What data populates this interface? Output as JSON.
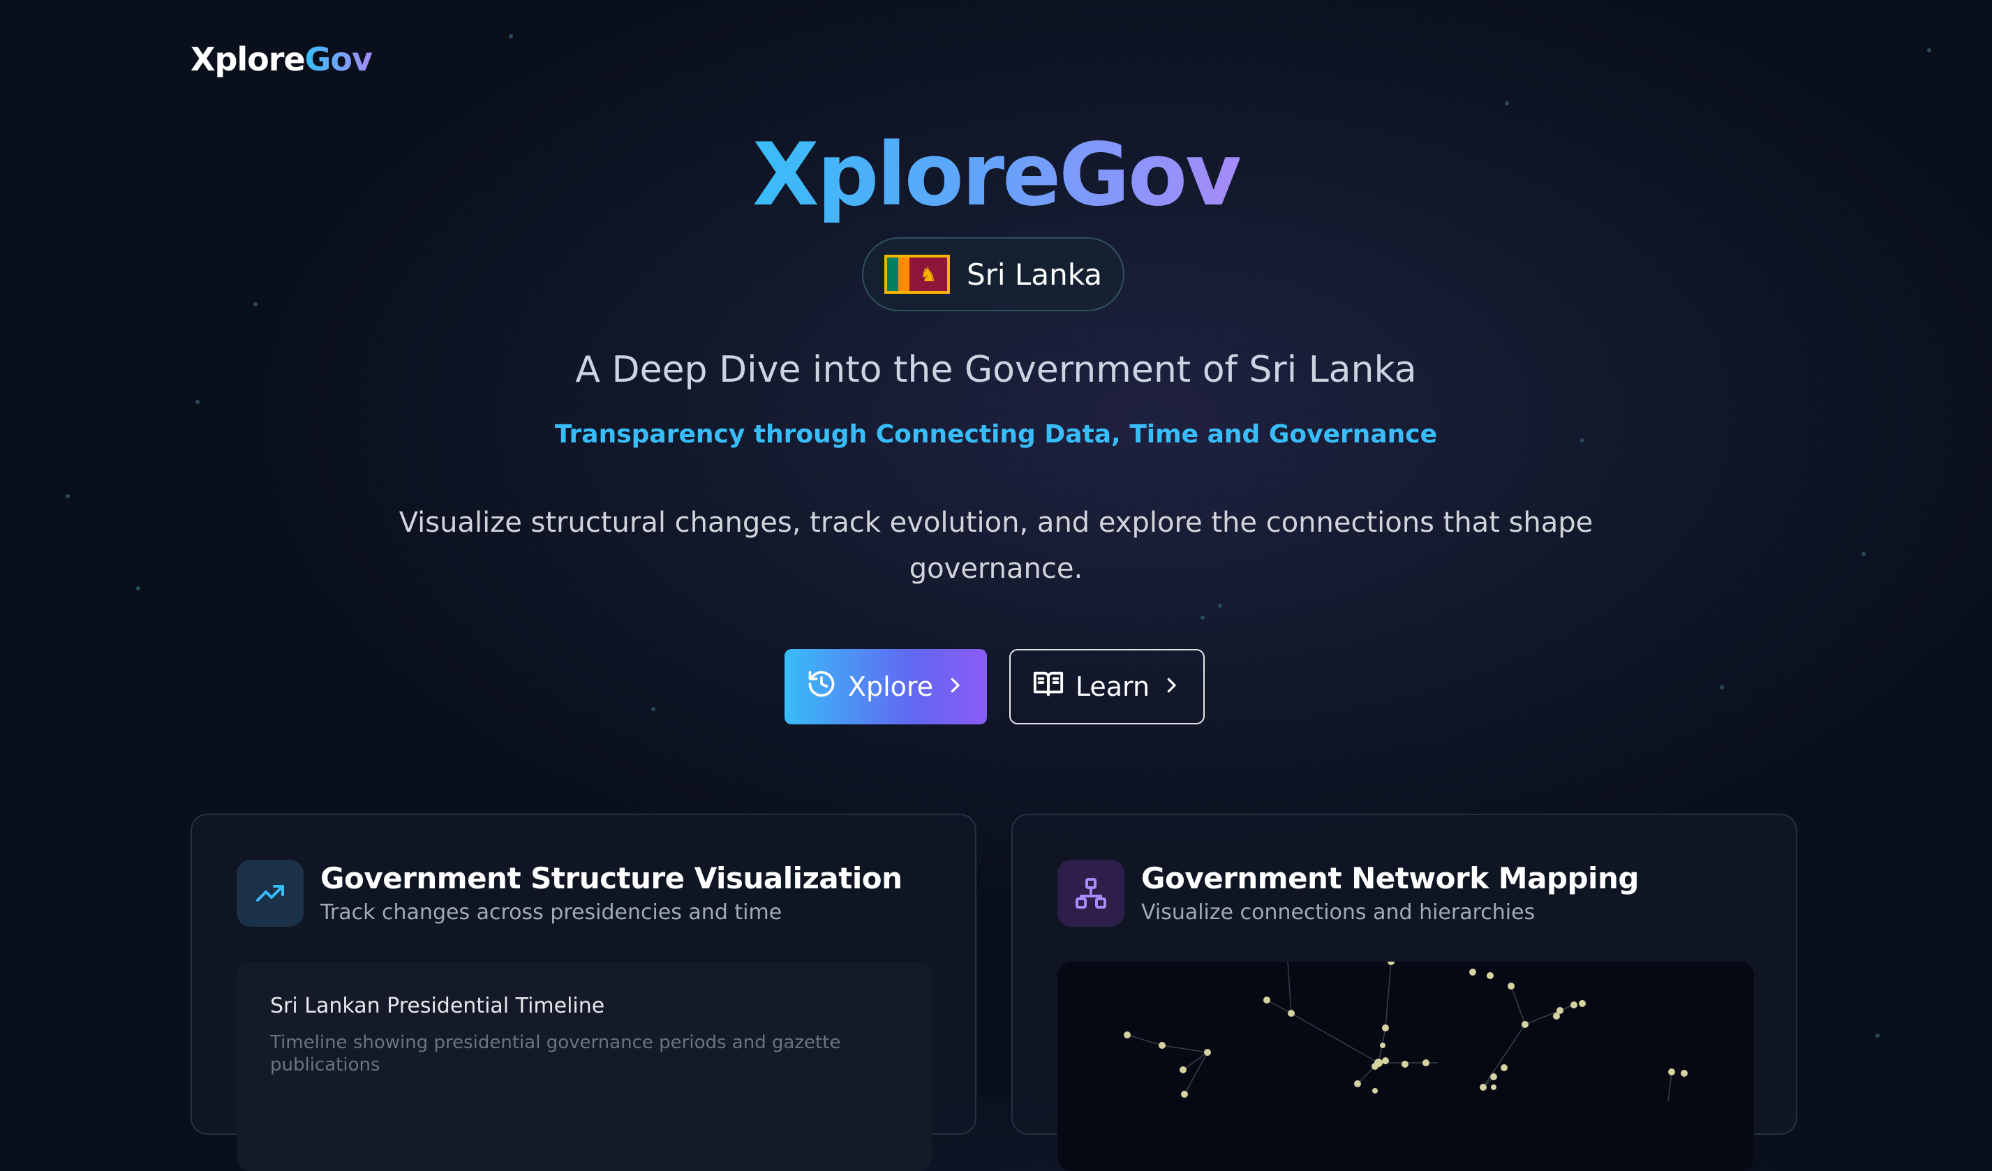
{
  "header": {
    "brand_part1": "Xplore",
    "brand_part2": "Gov"
  },
  "hero": {
    "title": "XploreGov",
    "country": "Sri Lanka",
    "subtitle": "A Deep Dive into the Government of Sri Lanka",
    "tagline": "Transparency through Connecting Data, Time and Governance",
    "description": "Visualize structural changes, track evolution, and explore the connections that shape governance."
  },
  "buttons": {
    "xplore_label": "Xplore",
    "learn_label": "Learn"
  },
  "cards": [
    {
      "title": "Government Structure Visualization",
      "subtitle": "Track changes across presidencies and time",
      "icon": "trending-up-icon",
      "panel_title": "Sri Lankan Presidential Timeline",
      "panel_description": "Timeline showing presidential governance periods and gazette publications"
    },
    {
      "title": "Government Network Mapping",
      "subtitle": "Visualize connections and hierarchies",
      "icon": "network-icon"
    }
  ],
  "colors": {
    "accent_cyan": "#38bdf8",
    "accent_purple": "#a78bfa",
    "background": "#0f1424"
  }
}
